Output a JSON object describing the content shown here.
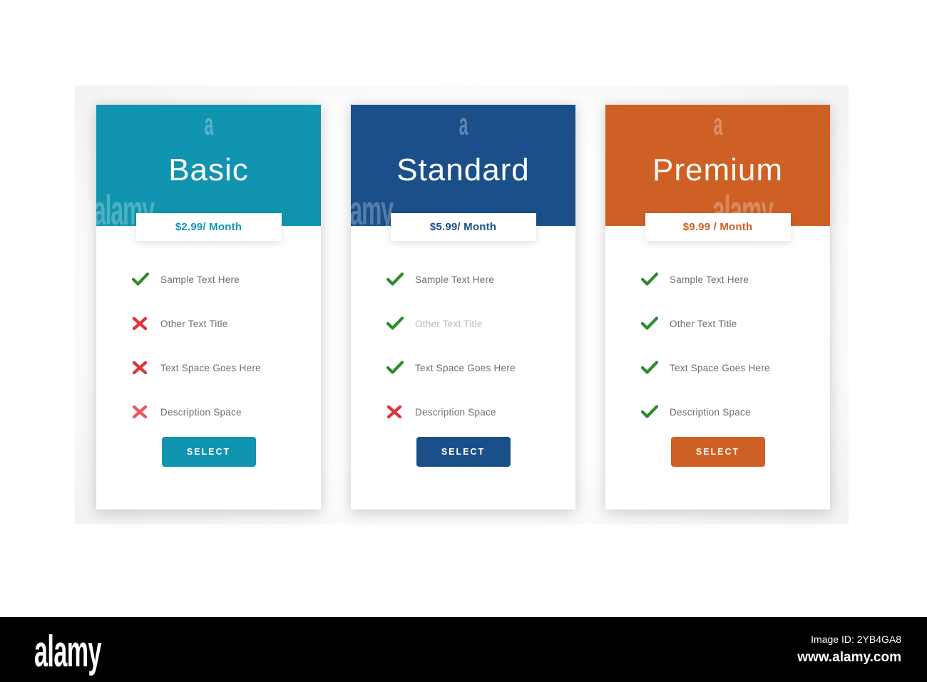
{
  "page": {
    "background": "#ffffff",
    "watermark_glyph": "a",
    "watermark_word": "alamy"
  },
  "colors": {
    "basic": "#1094AF",
    "standard": "#1B4F8A",
    "premium": "#CE6025",
    "check_green": "#2E8B2E",
    "cross_red": "#E0343C",
    "label_gray": "#6e6e6e",
    "label_gray_faded": "#b9bcbe"
  },
  "plans": [
    {
      "id": "basic",
      "title": "Basic",
      "price": "$2.99/ Month",
      "accent": "#1094AF",
      "price_color": "#1094AF",
      "button_label": "SELECT",
      "features": [
        {
          "label": "Sample Text Here",
          "icon": "check-icon",
          "included": true,
          "faded": false
        },
        {
          "label": "Other Text Title",
          "icon": "cross-icon",
          "included": false,
          "faded": false
        },
        {
          "label": "Text Space Goes Here",
          "icon": "cross-icon",
          "included": false,
          "faded": false
        },
        {
          "label": "Description Space",
          "icon": "cross-icon",
          "included": false,
          "faded": false
        }
      ]
    },
    {
      "id": "standard",
      "title": "Standard",
      "price": "$5.99/ Month",
      "accent": "#1B4F8A",
      "price_color": "#1B4F8A",
      "button_label": "SELECT",
      "features": [
        {
          "label": "Sample Text Here",
          "icon": "check-icon",
          "included": true,
          "faded": false
        },
        {
          "label": "Other Text Title",
          "icon": "check-icon",
          "included": true,
          "faded": true
        },
        {
          "label": "Text Space Goes Here",
          "icon": "check-icon",
          "included": true,
          "faded": false
        },
        {
          "label": "Description Space",
          "icon": "cross-icon",
          "included": false,
          "faded": false
        }
      ]
    },
    {
      "id": "premium",
      "title": "Premium",
      "price": "$9.99 / Month",
      "accent": "#CE6025",
      "price_color": "#CE6025",
      "button_label": "SELECT",
      "features": [
        {
          "label": "Sample Text Here",
          "icon": "check-icon",
          "included": true,
          "faded": false
        },
        {
          "label": "Other Text Title",
          "icon": "check-icon",
          "included": true,
          "faded": false
        },
        {
          "label": "Text Space Goes Here",
          "icon": "check-icon",
          "included": true,
          "faded": false
        },
        {
          "label": "Description Space",
          "icon": "check-icon",
          "included": true,
          "faded": false
        }
      ]
    }
  ],
  "footer": {
    "logo": "alamy",
    "image_id": "Image ID: 2YB4GA8",
    "url": "www.alamy.com"
  }
}
